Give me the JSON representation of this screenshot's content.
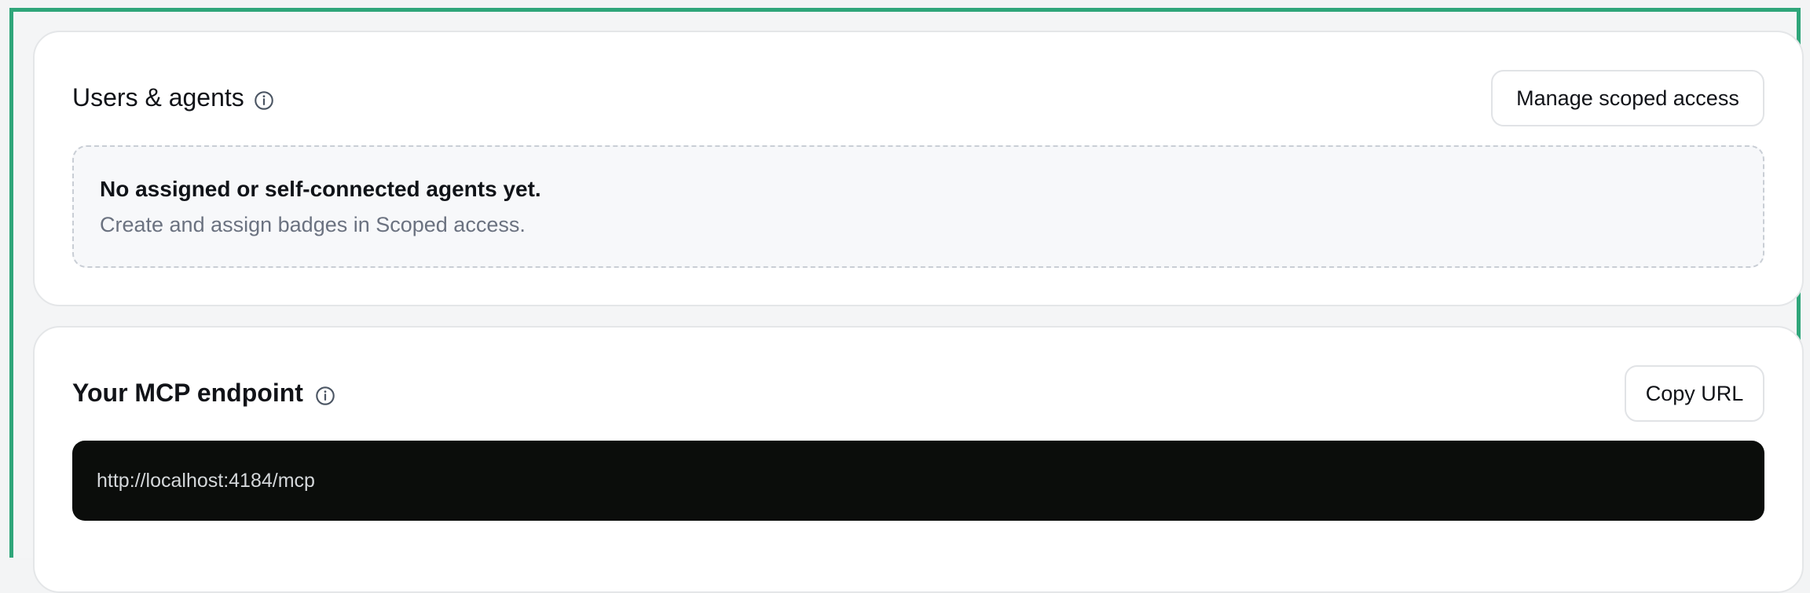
{
  "users_section": {
    "title": "Users & agents",
    "info_icon": "info-circle-icon",
    "manage_button_label": "Manage scoped access",
    "empty_state": {
      "title": "No assigned or self-connected agents yet.",
      "description": "Create and assign badges in Scoped access."
    }
  },
  "mcp_section": {
    "title": "Your MCP endpoint",
    "info_icon": "info-circle-icon",
    "copy_button_label": "Copy URL",
    "url": "http://localhost:4184/mcp"
  },
  "colors": {
    "frame_accent": "#2fa67a",
    "card_background": "#ffffff",
    "url_box_background": "#0b0d0b",
    "muted_text": "#6b7280"
  }
}
